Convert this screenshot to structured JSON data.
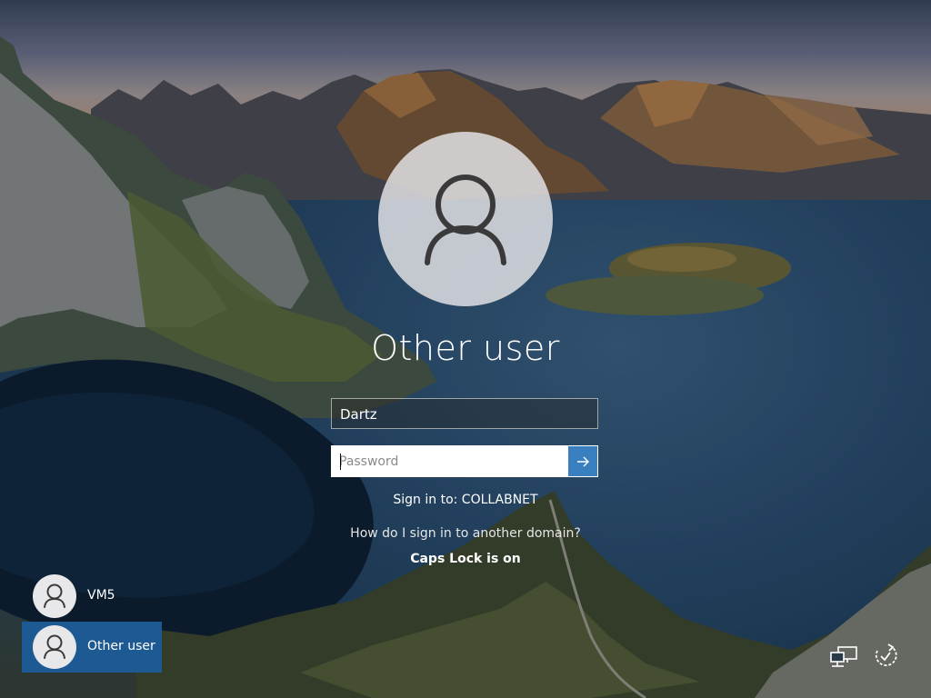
{
  "login": {
    "user_title": "Other user",
    "username_value": "Dartz",
    "password_placeholder": "Password",
    "submit_icon": "arrow-right-icon",
    "sign_in_to": "Sign in to: COLLABNET",
    "domain_help_link": "How do I sign in to another domain?",
    "caps_lock_warning": "Caps Lock is on"
  },
  "users": [
    {
      "name": "VM5",
      "selected": false
    },
    {
      "name": "Other user",
      "selected": true
    }
  ],
  "tray": {
    "network_icon": "network-icon",
    "ease_of_access_icon": "ease-of-access-icon"
  },
  "colors": {
    "accent": "#3a7fbf",
    "selected_user": "#1d5a93"
  }
}
